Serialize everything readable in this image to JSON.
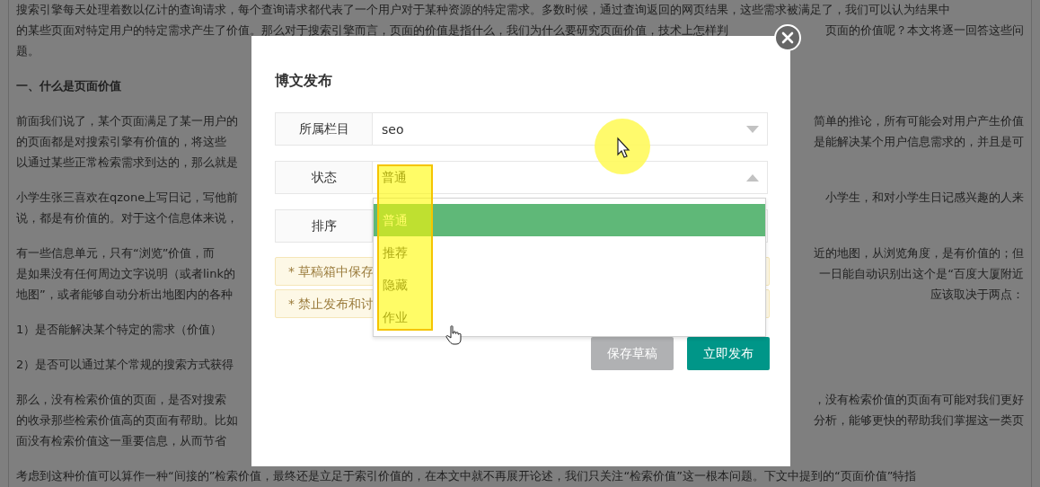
{
  "article": {
    "paragraphs": [
      {
        "kind": "text",
        "lines": [
          {
            "left": "搜索引擎每天处理着数以亿计的查询请求，每个查询请求都代表了一个用户对于某种资源的特定需求。多数时候，通过查询返回的网页结果，这些需求被满足了，我们可以认为结果中"
          },
          {
            "left": "的某些页面对特定用户的特定需求产生了价值。那么对于搜索引擎而言，页面的价值是指什么，我们为什么要研究页面价值，技术上怎样判",
            "right": "页面的价值呢？本文将逐一回答这些问"
          },
          {
            "left": "题。"
          }
        ]
      },
      {
        "kind": "heading",
        "lines": [
          {
            "left": "一、什么是页面价值"
          }
        ]
      },
      {
        "kind": "text",
        "lines": [
          {
            "left": "前面我们说了，某个页面满足了某一用户的",
            "right": "简单的推论，所有可能会对用户产生价值"
          },
          {
            "left": "的页面都是对搜索引擎有价值的，将这些",
            "right": "是能解决某个用户信息需求的，并且是可"
          },
          {
            "left": "以通过某些正常检索需求到达的，那么就是"
          }
        ]
      },
      {
        "kind": "text",
        "lines": [
          {
            "left": "小学生张三喜欢在qzone上写日记，写他前",
            "right": "小学生，和对小学生日记感兴趣的人来"
          },
          {
            "left": "说，都是有价值的。对于这个信息体来说，"
          }
        ]
      },
      {
        "kind": "text",
        "lines": [
          {
            "left": "有一些信息单元，只有“浏览”价值，而",
            "right": "近的地图，从浏览角度，是有价值的；但"
          },
          {
            "left": "是如果没有任何周边文字说明（或者link的",
            "right": "一日能自动识别出这个是“百度大厦附近"
          },
          {
            "left": "地图”，或者能够自动分析出地图内的各种",
            "right": "应该取决于两点："
          }
        ]
      },
      {
        "kind": "text",
        "lines": [
          {
            "left": "1）是否能解决某个特定的需求（价值）"
          }
        ]
      },
      {
        "kind": "text",
        "lines": [
          {
            "left": "2）是否可以通过某个常规的搜索方式获得"
          }
        ]
      },
      {
        "kind": "text",
        "lines": [
          {
            "left": "那么，没有检索价值的页面，是否对搜索",
            "right": "，没有检索价值的页面有可能对我们更好"
          },
          {
            "left": "的收录那些检索价值高的页面有帮助。比如",
            "right": "分析，能够更快的帮助我们掌握这一类页"
          },
          {
            "left": "面没有检索价值这一重要信息，从而节省"
          }
        ]
      },
      {
        "kind": "text",
        "lines": [
          {
            "left": "考虑到这种价值可以算作一种“间接的”检索价值，最终还是立足于索引价值的，在本文中就不再展开论述，我们只关注“检索价值”这一根本问题。下文中提到的“页面价值”特指"
          }
        ]
      }
    ]
  },
  "dialog": {
    "title": "博文发布",
    "fields": [
      {
        "label": "所属栏目",
        "value": "seo",
        "kind": "select",
        "expanded": false
      },
      {
        "label": "状态",
        "value": "普通",
        "kind": "select",
        "expanded": true
      },
      {
        "label": "排序",
        "kind": "select"
      }
    ],
    "dropdown": {
      "options": [
        {
          "label": "普通",
          "selected": true
        },
        {
          "label": "推荐",
          "selected": false
        },
        {
          "label": "隐藏",
          "selected": false
        },
        {
          "label": "作业",
          "selected": false
        }
      ]
    },
    "notices": [
      "* 草稿箱中保存",
      "* 禁止发布和讨"
    ],
    "buttons": [
      {
        "label": "保存草稿",
        "kind": "secondary"
      },
      {
        "label": "立即发布",
        "kind": "primary"
      }
    ]
  }
}
